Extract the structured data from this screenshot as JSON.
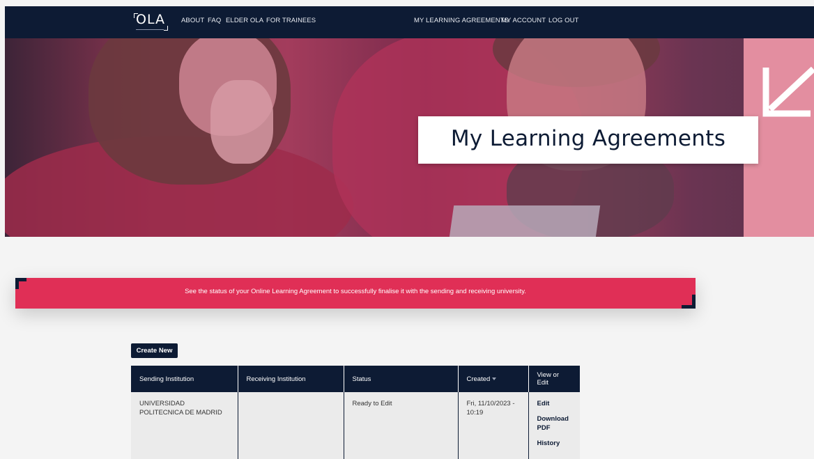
{
  "nav": {
    "logo": "OLA",
    "links": [
      "ABOUT",
      "FAQ",
      "ELDER OLA",
      "FOR TRAINEES"
    ],
    "right_links": [
      "MY LEARNING AGREEMENTS",
      "MY ACCOUNT",
      "LOG OUT"
    ]
  },
  "hero": {
    "title": "My Learning Agreements"
  },
  "banner": {
    "text": "See the status of your Online Learning Agreement to successfully finalise it with the sending and receiving university."
  },
  "create_button": "Create New",
  "table": {
    "headers": [
      "Sending Institution",
      "Receiving Institution",
      "Status",
      "Created",
      "View or Edit"
    ],
    "rows": [
      {
        "sending": "UNIVERSIDAD POLITECNICA DE MADRID",
        "receiving": "",
        "status": "Ready to Edit",
        "created": "Fri, 11/10/2023 - 10:19",
        "actions": [
          "Edit",
          "Download PDF",
          "History"
        ]
      }
    ]
  },
  "colors": {
    "navy": "#0d1b34",
    "accent_red": "#e02f56",
    "pink": "#e38ea0"
  }
}
